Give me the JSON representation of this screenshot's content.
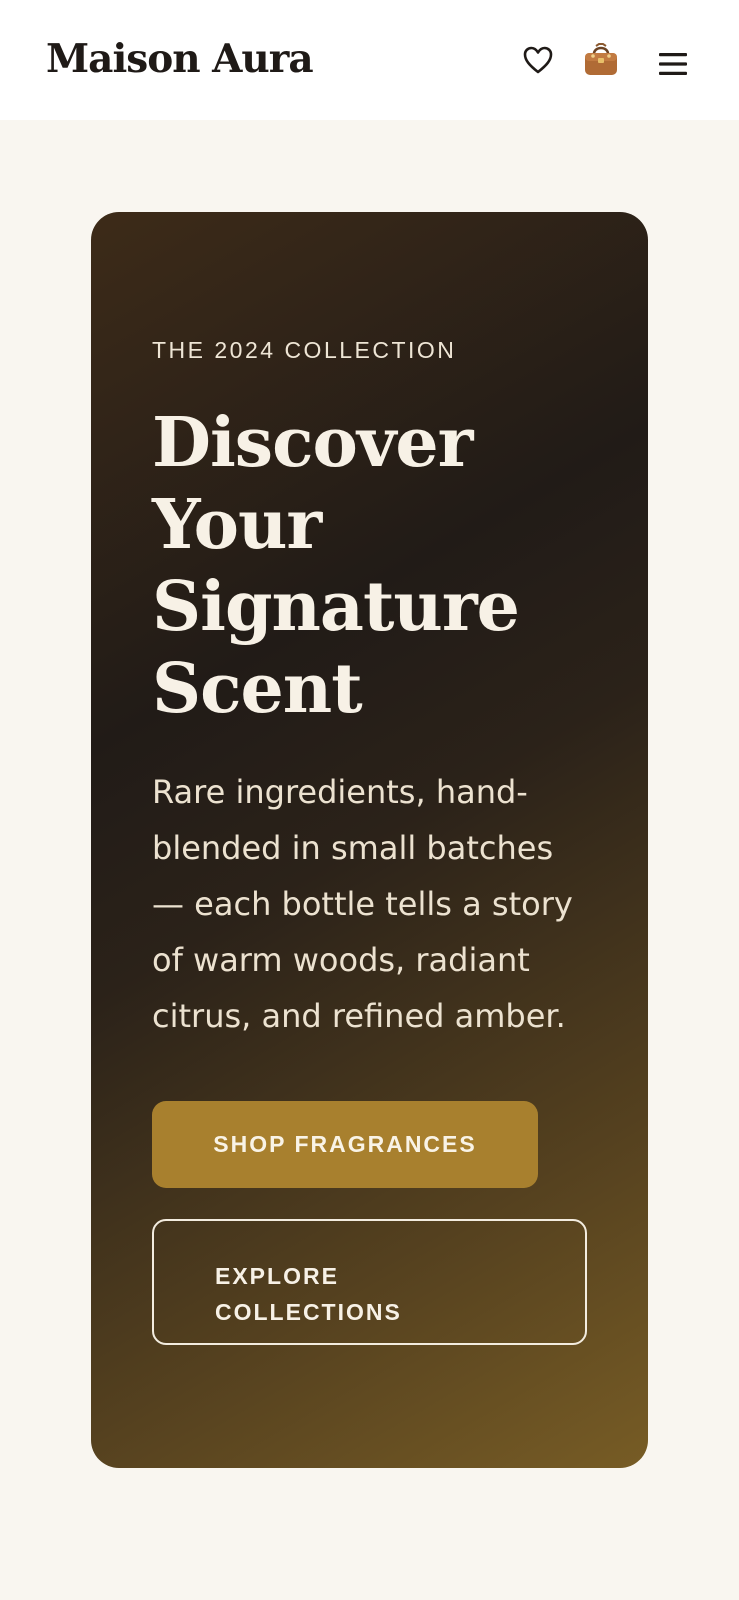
{
  "header": {
    "brand": "Maison Aura",
    "icons": [
      "heart-icon",
      "shopping-bag-icon",
      "hamburger-menu-icon"
    ]
  },
  "hero": {
    "eyebrow": "THE 2024 COLLECTION",
    "headline_lines": [
      "Discover",
      "Your",
      "Signature",
      "Scent"
    ],
    "description": "Rare ingredients, hand-blended in small batches — each bottle tells a story of warm woods, radiant citrus, and refined amber.",
    "primary_cta": "SHOP FRAGRANCES",
    "secondary_cta": "EXPLORE COLLECTIONS"
  },
  "colors": {
    "background": "#f9f6f0",
    "header_bg": "#ffffff",
    "hero_dark": "#211b17",
    "hero_gold": "#775c25",
    "accent": "#a8802e",
    "text_light": "#f7f1e6"
  }
}
